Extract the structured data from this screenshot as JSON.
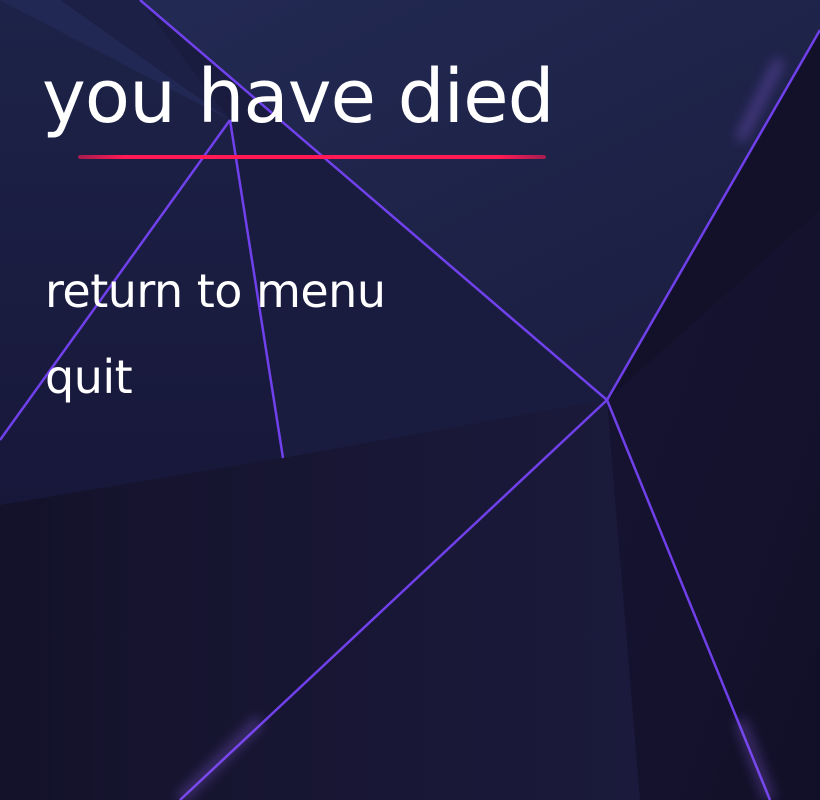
{
  "title": "you have died",
  "menu": {
    "items": [
      {
        "label": "return to menu"
      },
      {
        "label": "quit"
      }
    ]
  },
  "colors": {
    "background": "#16142e",
    "panel_light": "#222a52",
    "panel_dark": "#141127",
    "glow": "#6b3cf0",
    "accent_underline": "#ff1a55",
    "text": "#ffffff"
  }
}
